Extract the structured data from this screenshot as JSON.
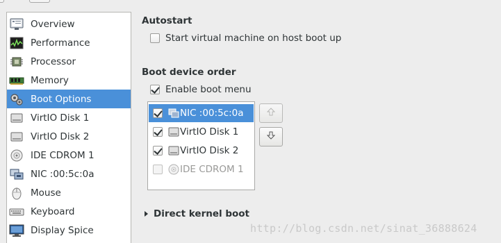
{
  "sidebar": {
    "items": [
      {
        "label": "Overview",
        "icon": "info-icon"
      },
      {
        "label": "Performance",
        "icon": "performance-graph-icon"
      },
      {
        "label": "Processor",
        "icon": "processor-chip-icon"
      },
      {
        "label": "Memory",
        "icon": "memory-module-icon"
      },
      {
        "label": "Boot Options",
        "icon": "gears-icon",
        "selected": true
      },
      {
        "label": "VirtIO Disk 1",
        "icon": "hard-disk-icon"
      },
      {
        "label": "VirtIO Disk 2",
        "icon": "hard-disk-icon"
      },
      {
        "label": "IDE CDROM 1",
        "icon": "cdrom-icon"
      },
      {
        "label": "NIC :00:5c:0a",
        "icon": "network-card-icon"
      },
      {
        "label": "Mouse",
        "icon": "mouse-icon"
      },
      {
        "label": "Keyboard",
        "icon": "keyboard-icon"
      },
      {
        "label": "Display Spice",
        "icon": "display-monitor-icon"
      }
    ]
  },
  "autostart": {
    "title": "Autostart",
    "option_label": "Start virtual machine on host boot up",
    "checked": false
  },
  "boot_order": {
    "title": "Boot device order",
    "enable_menu_label": "Enable boot menu",
    "enable_menu_checked": true,
    "devices": [
      {
        "label": "NIC :00:5c:0a",
        "checked": true,
        "icon": "network-card-icon",
        "selected": true
      },
      {
        "label": "VirtIO Disk 1",
        "checked": true,
        "icon": "hard-disk-icon"
      },
      {
        "label": "VirtIO Disk 2",
        "checked": true,
        "icon": "hard-disk-icon"
      },
      {
        "label": "IDE CDROM 1",
        "checked": false,
        "icon": "cdrom-icon",
        "disabled": true
      }
    ],
    "move_up_icon": "arrow-up-icon",
    "move_down_icon": "arrow-down-icon"
  },
  "direct_kernel_boot": {
    "label": "Direct kernel boot",
    "expanded": false
  },
  "watermark": "http://blog.csdn.net/sinat_36888624",
  "colors": {
    "selection": "#4a90d9",
    "background": "#ededed",
    "text": "#2e3436"
  }
}
